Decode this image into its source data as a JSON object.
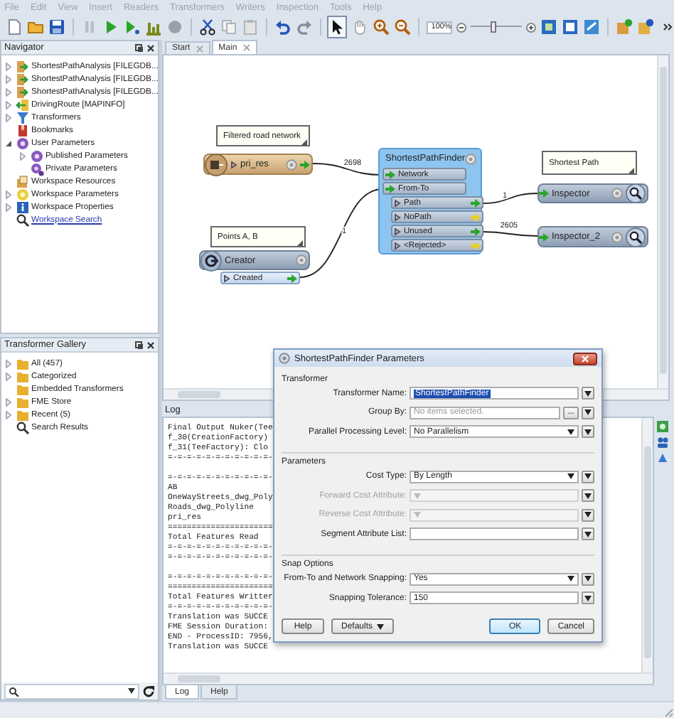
{
  "menu": [
    "File",
    "Edit",
    "View",
    "Insert",
    "Readers",
    "Transformers",
    "Writers",
    "Inspection",
    "Tools",
    "Help"
  ],
  "toolbar": {
    "zoom": "100%",
    "zoom_slider": {
      "level": 0.45
    }
  },
  "navigator": {
    "title": "Navigator",
    "items": [
      {
        "label": "ShortestPathAnalysis [FILEGDB...",
        "kind": "dataset",
        "expanded": false
      },
      {
        "label": "ShortestPathAnalysis [FILEGDB...",
        "kind": "dataset",
        "expanded": false
      },
      {
        "label": "ShortestPathAnalysis [FILEGDB...",
        "kind": "dataset",
        "expanded": false
      },
      {
        "label": "DrivingRoute [MAPINFO]",
        "kind": "writer",
        "expanded": false
      },
      {
        "label": "Transformers",
        "kind": "transformers",
        "expanded": false
      },
      {
        "label": "Bookmarks",
        "kind": "bookmarks"
      },
      {
        "label": "User Parameters",
        "kind": "parameters",
        "expanded": true,
        "children": [
          {
            "label": "Published Parameters",
            "kind": "parameters",
            "expanded": false
          },
          {
            "label": "Private Parameters",
            "kind": "private"
          }
        ]
      },
      {
        "label": "Workspace Resources",
        "kind": "resources"
      },
      {
        "label": "Workspace Parameters",
        "kind": "settings",
        "expanded": false
      },
      {
        "label": "Workspace Properties",
        "kind": "properties",
        "expanded": false
      },
      {
        "label": "Workspace Search",
        "kind": "search"
      }
    ]
  },
  "canvas_tabs": [
    {
      "label": "Start",
      "selected": false
    },
    {
      "label": "Main",
      "selected": true
    }
  ],
  "canvas": {
    "annotations": [
      "Filtered road network",
      "Points A, B",
      "Shortest Path"
    ],
    "nodes": [
      {
        "kind": "reader",
        "name": "pri_res"
      },
      {
        "kind": "creator",
        "name": "Creator",
        "outputs": [
          {
            "label": "Created",
            "connected": true
          }
        ]
      },
      {
        "kind": "transformer",
        "name": "ShortestPathFinder",
        "inputs": [
          "Network",
          "From-To"
        ],
        "outputs": [
          {
            "label": "Path",
            "connected": true
          },
          {
            "label": "NoPath",
            "connected": false
          },
          {
            "label": "Unused",
            "connected": true
          },
          {
            "label": "<Rejected>",
            "connected": false
          }
        ]
      },
      {
        "kind": "inspector",
        "name": "Inspector"
      },
      {
        "kind": "inspector",
        "name": "Inspector_2"
      }
    ],
    "links": [
      "2698",
      "1",
      "1",
      "2605"
    ]
  },
  "gallery": {
    "title": "Transformer Gallery",
    "items": [
      {
        "label": "All (457)",
        "kind": "folder",
        "expanded": false
      },
      {
        "label": "Categorized",
        "kind": "folder",
        "expanded": false
      },
      {
        "label": "Embedded Transformers",
        "kind": "folder"
      },
      {
        "label": "FME Store",
        "kind": "folder",
        "expanded": false
      },
      {
        "label": "Recent (5)",
        "kind": "folder",
        "expanded": false
      },
      {
        "label": "Search Results",
        "kind": "search"
      }
    ]
  },
  "log": {
    "title": "Log",
    "blocks": [
      [
        "Final Output Nuker(Tee",
        "f_30(CreationFactory)",
        "f_31(TeeFactory): Clo",
        "=-=-=-=-=-=-=-=-=-=-=-"
      ],
      [
        "=-=-=-=-=-=-=-=-=-=-=-",
        "AB",
        "OneWayStreets_dwg_Poly",
        "Roads_dwg_Polyline",
        "pri_res",
        "======================",
        "Total Features Read",
        "=-=-=-=-=-=-=-=-=-=-=-",
        "=-=-=-=-=-=-=-=-=-=-=-"
      ],
      [
        "=-=-=-=-=-=-=-=-=-=-=-",
        "======================",
        "Total Features Writter",
        "=-=-=-=-=-=-=-=-=-=-=-",
        "Translation was SUCCE",
        "FME Session Duration:",
        "END - ProcessID: 7956,",
        "Translation was SUCCE"
      ]
    ]
  },
  "bottom_tabs": [
    {
      "label": "Log",
      "selected": true
    },
    {
      "label": "Help",
      "selected": false
    }
  ],
  "dialog": {
    "title": "ShortestPathFinder Parameters",
    "sections": [
      {
        "title": "Transformer",
        "fields": [
          {
            "label": "Transformer Name:",
            "kind": "text",
            "value": "ShortestPathFinder",
            "text_selected": true,
            "disabled": false
          },
          {
            "label": "Group By:",
            "kind": "list",
            "placeholder": "No items selected.",
            "browse": "...",
            "disabled": false
          },
          {
            "label": "Parallel Processing Level:",
            "kind": "select",
            "value": "No Parallelism",
            "disabled": false
          }
        ]
      },
      {
        "title": "Parameters",
        "fields": [
          {
            "label": "Cost Type:",
            "kind": "select",
            "value": "By Length",
            "disabled": false
          },
          {
            "label": "Forward Cost Attribute:",
            "kind": "select",
            "disabled": true
          },
          {
            "label": "Reverse Cost Attribute:",
            "kind": "select",
            "disabled": true
          },
          {
            "label": "Segment Attribute List:",
            "kind": "text",
            "disabled": false
          }
        ]
      },
      {
        "title": "Snap Options",
        "fields": [
          {
            "label": "From-To and Network Snapping:",
            "kind": "select",
            "value": "Yes",
            "disabled": false
          },
          {
            "label": "Snapping Tolerance:",
            "kind": "text",
            "value": "150",
            "disabled": false
          }
        ]
      }
    ],
    "buttons": [
      {
        "label": "Help",
        "kind": "plain"
      },
      {
        "label": "Defaults",
        "kind": "menu"
      },
      {
        "label": "OK",
        "kind": "default"
      },
      {
        "label": "Cancel",
        "kind": "plain"
      }
    ]
  }
}
